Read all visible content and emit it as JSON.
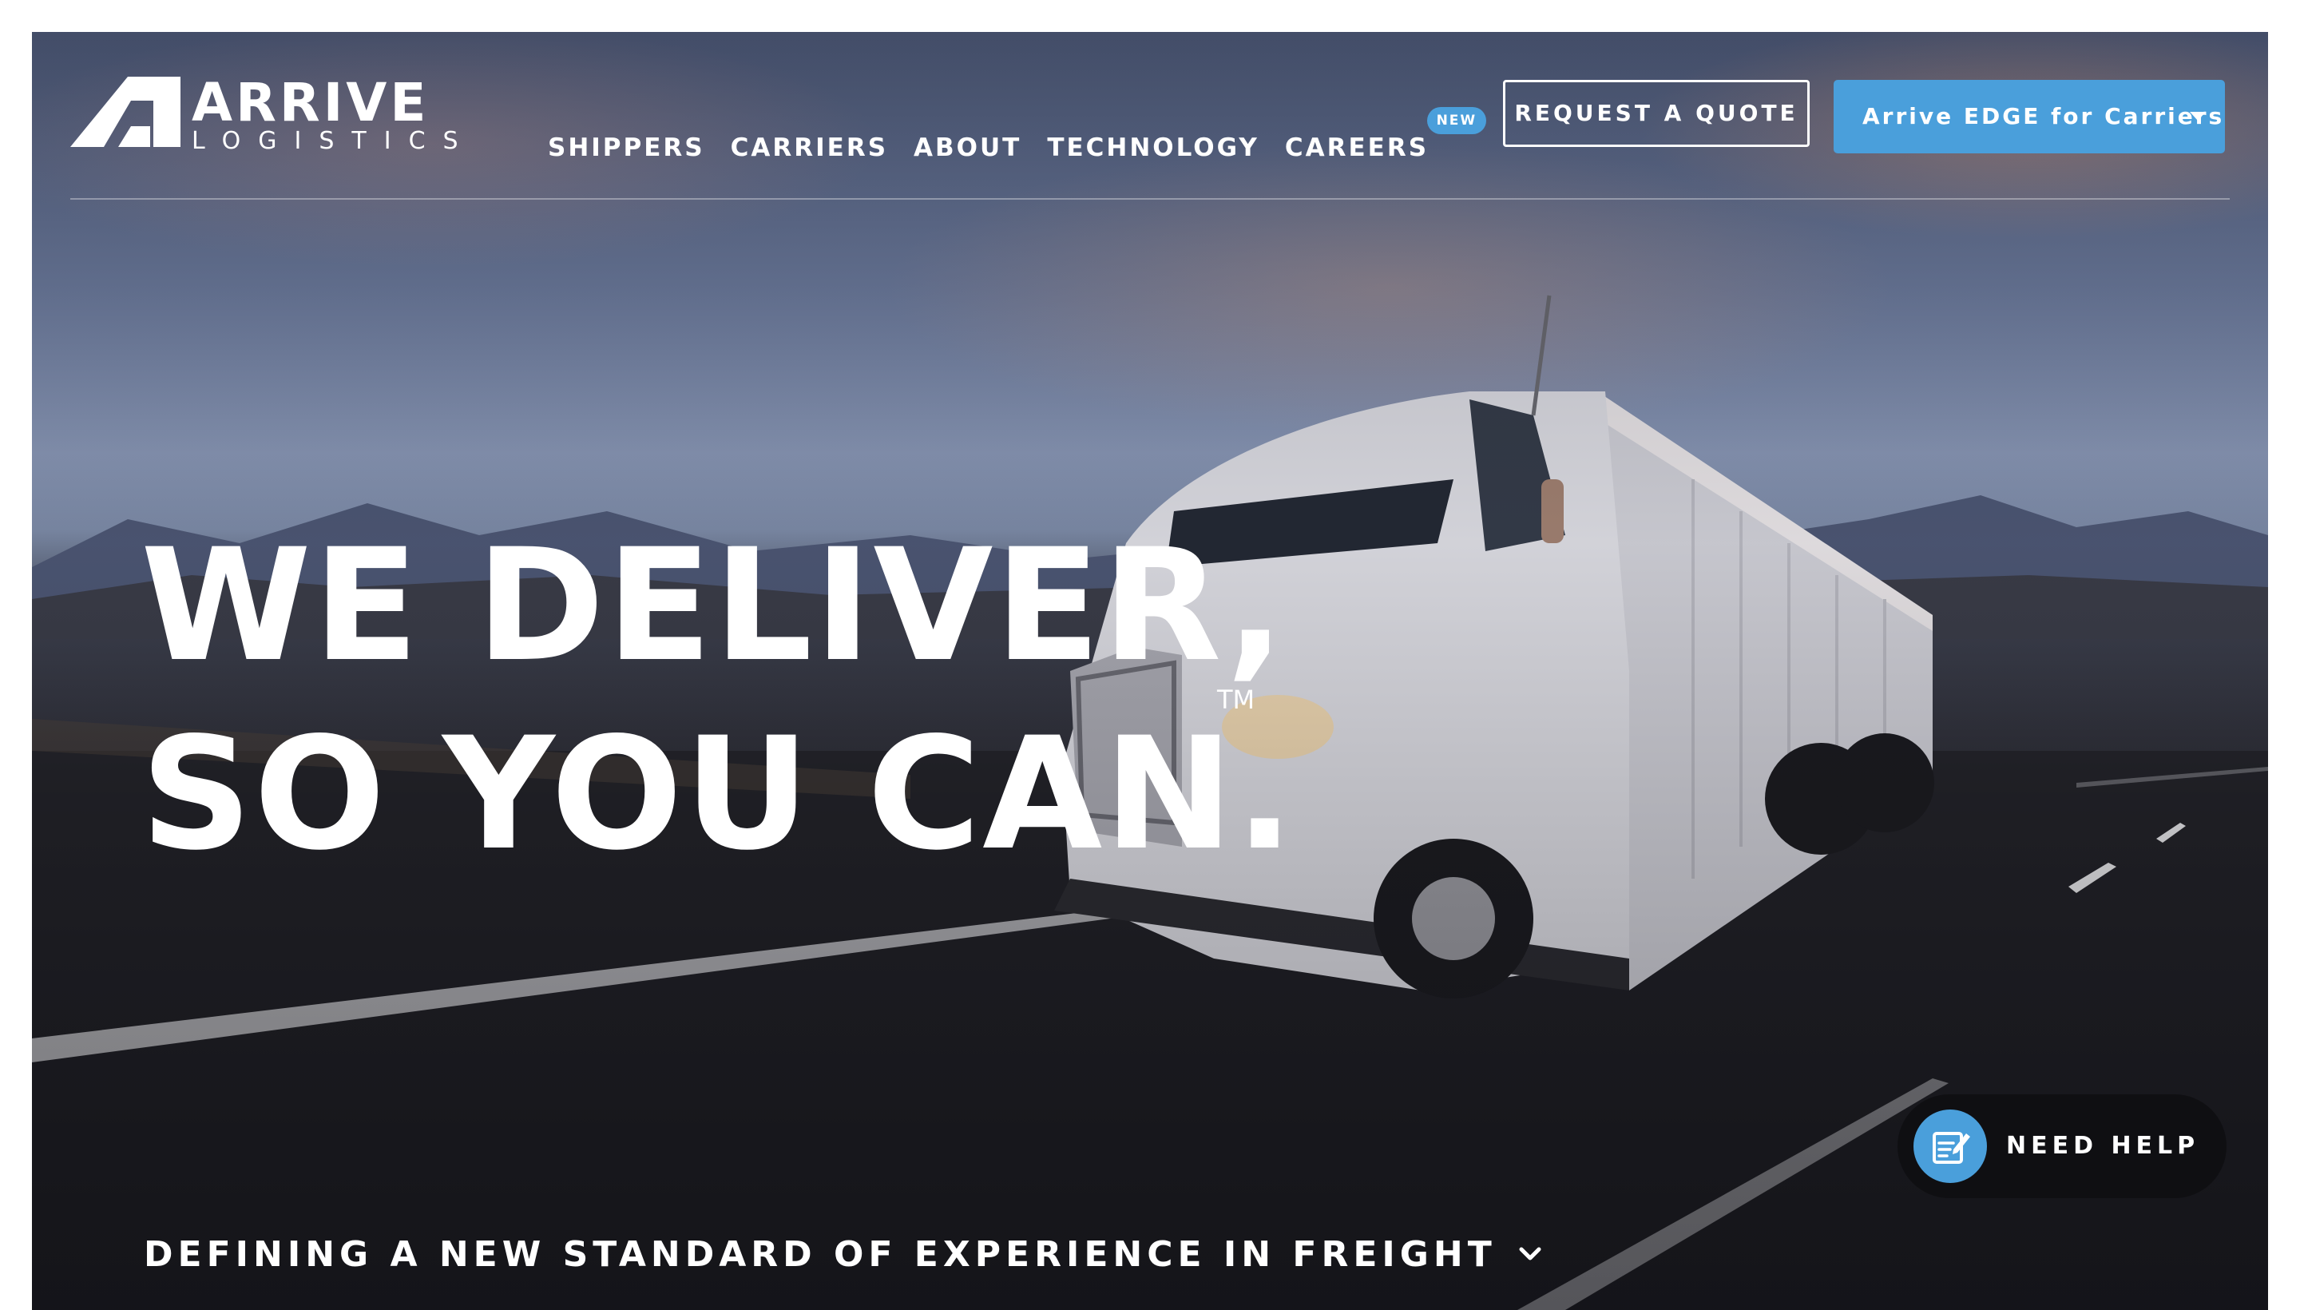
{
  "brand": {
    "name": "ARRIVE",
    "subname": "LOGISTICS"
  },
  "nav": {
    "links": [
      {
        "label": "SHIPPERS"
      },
      {
        "label": "CARRIERS"
      },
      {
        "label": "ABOUT"
      },
      {
        "label": "TECHNOLOGY"
      },
      {
        "label": "CAREERS",
        "badge": "NEW"
      }
    ],
    "quote_button": "REQUEST A QUOTE",
    "edge_button": "Arrive EDGE for Carriers"
  },
  "hero": {
    "line1": "WE DELIVER,",
    "line2": "SO YOU CAN.",
    "trademark": "TM",
    "tagline": "DEFINING A NEW STANDARD OF EXPERIENCE IN FREIGHT"
  },
  "help": {
    "label": "NEED HELP"
  },
  "icons": {
    "logo": "arrive-logo-icon",
    "dropdown": "caret-down-icon",
    "tagline_chevron": "chevron-down-icon",
    "help": "help-form-icon"
  },
  "colors": {
    "accent": "#4a9fdb",
    "help_bg": "#0f0f12",
    "text": "#ffffff"
  }
}
